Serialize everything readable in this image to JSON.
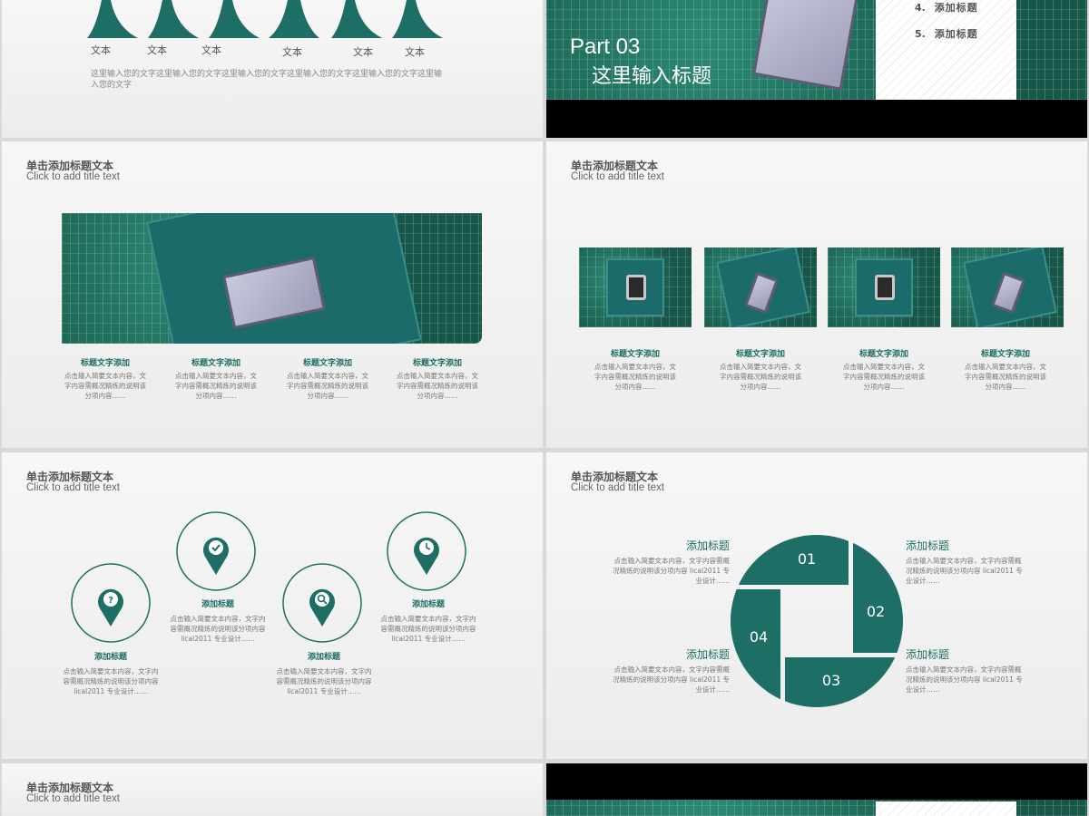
{
  "colors": {
    "accent": "#1d6e64",
    "text": "#555555",
    "muted": "#777777"
  },
  "common": {
    "title": "单击添加标题文本",
    "subtitle": "Click to add title text"
  },
  "slide1": {
    "labels": [
      "文本",
      "文本",
      "文本",
      "文本",
      "文本",
      "文本"
    ],
    "paragraph": "这里输入您的文字这里输入您的文字这里输入您的文字这里输入您的文字这里输入您的文字这里输入您的文字"
  },
  "slide2": {
    "part": "Part 03",
    "heading": "这里输入标题",
    "menu": [
      {
        "num": "4.",
        "label": "添加标题"
      },
      {
        "num": "5.",
        "label": "添加标题"
      }
    ]
  },
  "slide3": {
    "items": [
      {
        "title": "标题文字添加",
        "text": "点击输入简要文本内容，文字内容需概况精炼的说明该分项内容……"
      },
      {
        "title": "标题文字添加",
        "text": "点击输入简要文本内容，文字内容需概况精炼的说明该分项内容……"
      },
      {
        "title": "标题文字添加",
        "text": "点击输入简要文本内容，文字内容需概况精炼的说明该分项内容……"
      },
      {
        "title": "标题文字添加",
        "text": "点击输入简要文本内容，文字内容需概况精炼的说明该分项内容……"
      }
    ]
  },
  "slide4": {
    "items": [
      {
        "title": "标题文字添加",
        "text": "点击输入简要文本内容，文字内容需概况精炼的说明该分项内容……"
      },
      {
        "title": "标题文字添加",
        "text": "点击输入简要文本内容，文字内容需概况精炼的说明该分项内容……"
      },
      {
        "title": "标题文字添加",
        "text": "点击输入简要文本内容，文字内容需概况精炼的说明该分项内容……"
      },
      {
        "title": "标题文字添加",
        "text": "点击输入简要文本内容，文字内容需概况精炼的说明该分项内容……"
      }
    ]
  },
  "slide5": {
    "items": [
      {
        "title": "添加标题",
        "text": "点击输入简要文本内容，文字内容需概况精炼的说明该分项内容 lical2011 专业设计……",
        "icon": "question-pin-icon"
      },
      {
        "title": "添加标题",
        "text": "点击输入简要文本内容，文字内容需概况精炼的说明该分项内容 lical2011 专业设计……",
        "icon": "check-pin-icon"
      },
      {
        "title": "添加标题",
        "text": "点击输入简要文本内容，文字内容需概况精炼的说明该分项内容 lical2011 专业设计……",
        "icon": "search-pin-icon"
      },
      {
        "title": "添加标题",
        "text": "点击输入简要文本内容，文字内容需概况精炼的说明该分项内容 lical2011 专业设计……",
        "icon": "clock-pin-icon"
      }
    ]
  },
  "slide6": {
    "numbers": [
      "01",
      "02",
      "03",
      "04"
    ],
    "items": [
      {
        "title": "添加标题",
        "text": "点击输入简要文本内容，文字内容需概况精炼的说明该分项内容 lical2011 专业设计……"
      },
      {
        "title": "添加标题",
        "text": "点击输入简要文本内容，文字内容需概况精炼的说明该分项内容 lical2011 专业设计……"
      },
      {
        "title": "添加标题",
        "text": "点击输入简要文本内容，文字内容需概况精炼的说明该分项内容 lical2011 专业设计……"
      },
      {
        "title": "添加标题",
        "text": "点击输入简要文本内容，文字内容需概况精炼的说明该分项内容 lical2011 专业设计……"
      }
    ]
  }
}
